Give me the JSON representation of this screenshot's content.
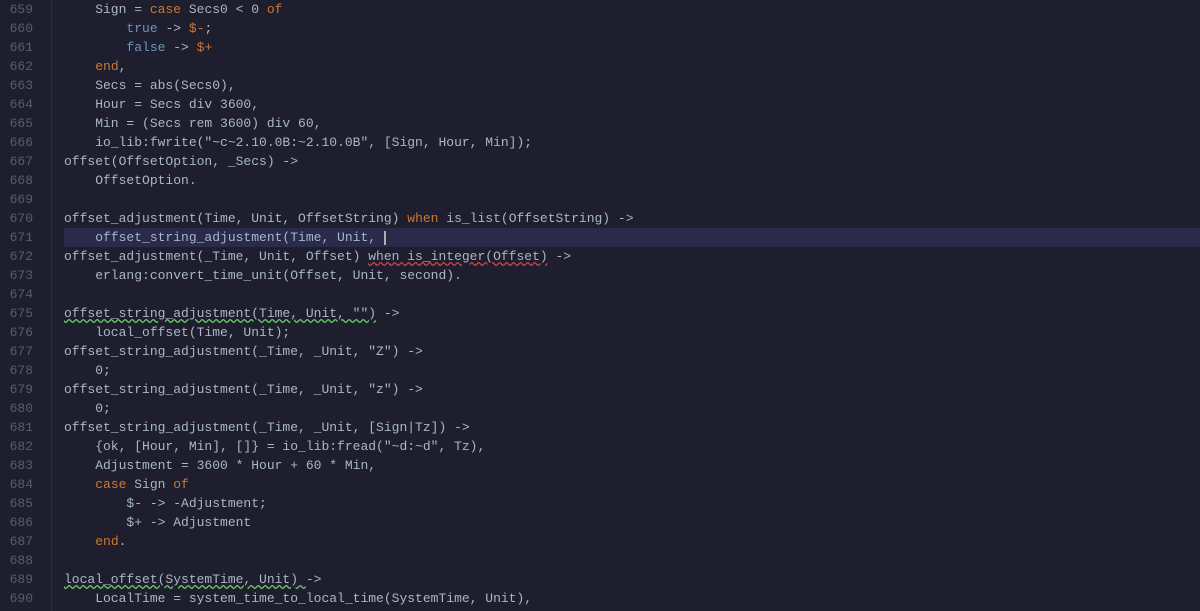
{
  "editor": {
    "background": "#1e1e2e",
    "lines": [
      {
        "num": 659,
        "tokens": [
          {
            "t": "    Sign = ",
            "c": "plain"
          },
          {
            "t": "case",
            "c": "kw"
          },
          {
            "t": " Secs0 < 0 ",
            "c": "plain"
          },
          {
            "t": "of",
            "c": "kw"
          }
        ]
      },
      {
        "num": 660,
        "tokens": [
          {
            "t": "        ",
            "c": "plain"
          },
          {
            "t": "true",
            "c": "atom"
          },
          {
            "t": " -> ",
            "c": "plain"
          },
          {
            "t": "$-",
            "c": "dollar"
          },
          {
            "t": ";",
            "c": "plain"
          }
        ]
      },
      {
        "num": 661,
        "tokens": [
          {
            "t": "        ",
            "c": "plain"
          },
          {
            "t": "false",
            "c": "atom"
          },
          {
            "t": " -> ",
            "c": "plain"
          },
          {
            "t": "$+",
            "c": "dollar"
          }
        ]
      },
      {
        "num": 662,
        "tokens": [
          {
            "t": "    ",
            "c": "plain"
          },
          {
            "t": "end",
            "c": "kw"
          },
          {
            "t": ",",
            "c": "plain"
          }
        ]
      },
      {
        "num": 663,
        "tokens": [
          {
            "t": "    Secs = abs(Secs0),",
            "c": "plain"
          }
        ]
      },
      {
        "num": 664,
        "tokens": [
          {
            "t": "    Hour = Secs div 3600,",
            "c": "plain"
          }
        ]
      },
      {
        "num": 665,
        "tokens": [
          {
            "t": "    Min = (Secs rem 3600) div 60,",
            "c": "plain"
          }
        ]
      },
      {
        "num": 666,
        "tokens": [
          {
            "t": "    io_lib:fwrite(\"~c~2.10.0B:~2.10.0B\", [Sign, Hour, Min]);",
            "c": "plain"
          }
        ]
      },
      {
        "num": 667,
        "tokens": [
          {
            "t": "offset(OffsetOption, _Secs) ->",
            "c": "plain"
          }
        ]
      },
      {
        "num": 668,
        "tokens": [
          {
            "t": "    OffsetOption.",
            "c": "plain"
          }
        ]
      },
      {
        "num": 669,
        "tokens": [
          {
            "t": "",
            "c": "plain"
          }
        ]
      },
      {
        "num": 670,
        "tokens": [
          {
            "t": "offset_adjustment(Time, Unit, OffsetString) ",
            "c": "plain"
          },
          {
            "t": "when",
            "c": "kw"
          },
          {
            "t": " is_list(OffsetString) ->",
            "c": "plain"
          }
        ]
      },
      {
        "num": 671,
        "tokens": [
          {
            "t": "    offset_string_adjustment(Time, Unit, ",
            "c": "plain"
          },
          {
            "t": "CURSOR",
            "c": "cursor"
          }
        ],
        "active": true
      },
      {
        "num": 672,
        "tokens": [
          {
            "t": "offset_adjustment(_Time, Unit, Offset) ",
            "c": "plain"
          },
          {
            "t": "when is_integer(Offset)",
            "c": "underline-red"
          },
          {
            "t": " ->",
            "c": "plain"
          }
        ]
      },
      {
        "num": 673,
        "tokens": [
          {
            "t": "    erlang:convert_time_unit(Offset, Unit, second).",
            "c": "plain"
          }
        ]
      },
      {
        "num": 674,
        "tokens": [
          {
            "t": "",
            "c": "plain"
          }
        ]
      },
      {
        "num": 675,
        "tokens": [
          {
            "t": "offset_string_adjustment(Time, Unit, \"\")",
            "c": "underline-green"
          },
          {
            "t": " ->",
            "c": "plain"
          }
        ]
      },
      {
        "num": 676,
        "tokens": [
          {
            "t": "    local_offset(Time, Unit);",
            "c": "plain"
          }
        ]
      },
      {
        "num": 677,
        "tokens": [
          {
            "t": "offset_string_adjustment(_Time, _Unit, \"Z\") ->",
            "c": "plain"
          }
        ]
      },
      {
        "num": 678,
        "tokens": [
          {
            "t": "    0;",
            "c": "plain"
          }
        ]
      },
      {
        "num": 679,
        "tokens": [
          {
            "t": "offset_string_adjustment(_Time, _Unit, \"z\") ->",
            "c": "plain"
          }
        ]
      },
      {
        "num": 680,
        "tokens": [
          {
            "t": "    0;",
            "c": "plain"
          }
        ]
      },
      {
        "num": 681,
        "tokens": [
          {
            "t": "offset_string_adjustment(_Time, _Unit, [Sign|Tz]) ->",
            "c": "plain"
          }
        ]
      },
      {
        "num": 682,
        "tokens": [
          {
            "t": "    {ok, [Hour, Min], []} = io_lib:fread(\"~d:~d\", Tz),",
            "c": "plain"
          }
        ]
      },
      {
        "num": 683,
        "tokens": [
          {
            "t": "    Adjustment = 3600 * Hour + 60 * Min,",
            "c": "plain"
          }
        ]
      },
      {
        "num": 684,
        "tokens": [
          {
            "t": "    ",
            "c": "plain"
          },
          {
            "t": "case",
            "c": "kw"
          },
          {
            "t": " Sign ",
            "c": "plain"
          },
          {
            "t": "of",
            "c": "kw"
          }
        ]
      },
      {
        "num": 685,
        "tokens": [
          {
            "t": "        $- -> -Adjustment;",
            "c": "plain"
          }
        ]
      },
      {
        "num": 686,
        "tokens": [
          {
            "t": "        $+ -> Adjustment",
            "c": "plain"
          }
        ]
      },
      {
        "num": 687,
        "tokens": [
          {
            "t": "    ",
            "c": "plain"
          },
          {
            "t": "end",
            "c": "kw"
          },
          {
            "t": ".",
            "c": "plain"
          }
        ]
      },
      {
        "num": 688,
        "tokens": [
          {
            "t": "",
            "c": "plain"
          }
        ]
      },
      {
        "num": 689,
        "tokens": [
          {
            "t": "local_offset(SystemTime, Unit) ",
            "c": "underline-green"
          },
          {
            "t": "->",
            "c": "plain"
          }
        ]
      },
      {
        "num": 690,
        "tokens": [
          {
            "t": "    LocalTime = system_time_to_local_time(SystemTime, Unit),",
            "c": "plain"
          }
        ]
      }
    ]
  }
}
